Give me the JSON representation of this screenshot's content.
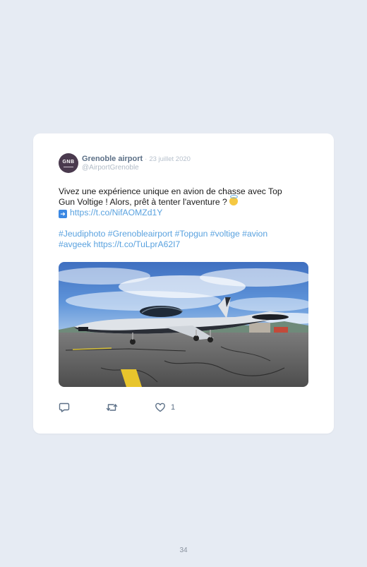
{
  "tweet": {
    "avatar_text": "GNB",
    "author_name": "Grenoble airport",
    "separator": "·",
    "date": "23 juillet 2020",
    "handle": "@AirportGrenoble",
    "text_line1": "Vivez une expérience unique en avion de chasse avec Top",
    "text_line2": "Gun Voltige ! Alors, prêt à tenter l'aventure ?",
    "emoji_1": "smiling-face-with-halo",
    "emoji_2": "right-arrow",
    "link_1": "https://t.co/NifAOMZd1Y",
    "hashtags_line1": "#Jeudiphoto #Grenobleairport #Topgun #voltige #avion",
    "hashtags_line2": "#avgeek",
    "link_2": "https://t.co/TuLprA62I7",
    "media_alt": "",
    "like_count": "1"
  },
  "actions": {
    "reply_icon": "reply-icon",
    "retweet_icon": "retweet-icon",
    "like_icon": "heart-icon"
  },
  "page_number": "34",
  "colors": {
    "background": "#e6ebf3",
    "card": "#ffffff",
    "author": "#5b6f86",
    "link": "#5aa2df",
    "muted": "#b1bbc6"
  }
}
